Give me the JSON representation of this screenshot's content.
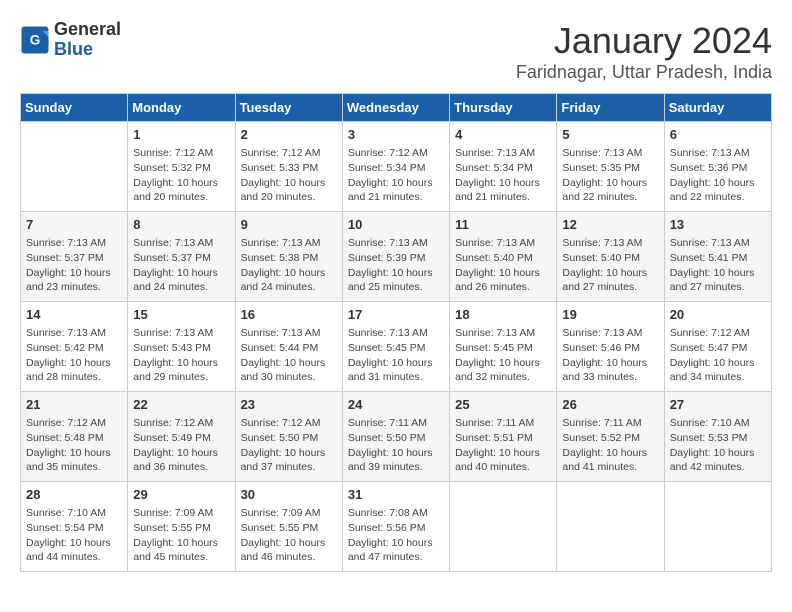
{
  "logo": {
    "general": "General",
    "blue": "Blue"
  },
  "title": "January 2024",
  "subtitle": "Faridnagar, Uttar Pradesh, India",
  "days": [
    "Sunday",
    "Monday",
    "Tuesday",
    "Wednesday",
    "Thursday",
    "Friday",
    "Saturday"
  ],
  "weeks": [
    [
      {
        "day": "",
        "content": ""
      },
      {
        "day": "1",
        "content": "Sunrise: 7:12 AM\nSunset: 5:32 PM\nDaylight: 10 hours\nand 20 minutes."
      },
      {
        "day": "2",
        "content": "Sunrise: 7:12 AM\nSunset: 5:33 PM\nDaylight: 10 hours\nand 20 minutes."
      },
      {
        "day": "3",
        "content": "Sunrise: 7:12 AM\nSunset: 5:34 PM\nDaylight: 10 hours\nand 21 minutes."
      },
      {
        "day": "4",
        "content": "Sunrise: 7:13 AM\nSunset: 5:34 PM\nDaylight: 10 hours\nand 21 minutes."
      },
      {
        "day": "5",
        "content": "Sunrise: 7:13 AM\nSunset: 5:35 PM\nDaylight: 10 hours\nand 22 minutes."
      },
      {
        "day": "6",
        "content": "Sunrise: 7:13 AM\nSunset: 5:36 PM\nDaylight: 10 hours\nand 22 minutes."
      }
    ],
    [
      {
        "day": "7",
        "content": "Sunrise: 7:13 AM\nSunset: 5:37 PM\nDaylight: 10 hours\nand 23 minutes."
      },
      {
        "day": "8",
        "content": "Sunrise: 7:13 AM\nSunset: 5:37 PM\nDaylight: 10 hours\nand 24 minutes."
      },
      {
        "day": "9",
        "content": "Sunrise: 7:13 AM\nSunset: 5:38 PM\nDaylight: 10 hours\nand 24 minutes."
      },
      {
        "day": "10",
        "content": "Sunrise: 7:13 AM\nSunset: 5:39 PM\nDaylight: 10 hours\nand 25 minutes."
      },
      {
        "day": "11",
        "content": "Sunrise: 7:13 AM\nSunset: 5:40 PM\nDaylight: 10 hours\nand 26 minutes."
      },
      {
        "day": "12",
        "content": "Sunrise: 7:13 AM\nSunset: 5:40 PM\nDaylight: 10 hours\nand 27 minutes."
      },
      {
        "day": "13",
        "content": "Sunrise: 7:13 AM\nSunset: 5:41 PM\nDaylight: 10 hours\nand 27 minutes."
      }
    ],
    [
      {
        "day": "14",
        "content": "Sunrise: 7:13 AM\nSunset: 5:42 PM\nDaylight: 10 hours\nand 28 minutes."
      },
      {
        "day": "15",
        "content": "Sunrise: 7:13 AM\nSunset: 5:43 PM\nDaylight: 10 hours\nand 29 minutes."
      },
      {
        "day": "16",
        "content": "Sunrise: 7:13 AM\nSunset: 5:44 PM\nDaylight: 10 hours\nand 30 minutes."
      },
      {
        "day": "17",
        "content": "Sunrise: 7:13 AM\nSunset: 5:45 PM\nDaylight: 10 hours\nand 31 minutes."
      },
      {
        "day": "18",
        "content": "Sunrise: 7:13 AM\nSunset: 5:45 PM\nDaylight: 10 hours\nand 32 minutes."
      },
      {
        "day": "19",
        "content": "Sunrise: 7:13 AM\nSunset: 5:46 PM\nDaylight: 10 hours\nand 33 minutes."
      },
      {
        "day": "20",
        "content": "Sunrise: 7:12 AM\nSunset: 5:47 PM\nDaylight: 10 hours\nand 34 minutes."
      }
    ],
    [
      {
        "day": "21",
        "content": "Sunrise: 7:12 AM\nSunset: 5:48 PM\nDaylight: 10 hours\nand 35 minutes."
      },
      {
        "day": "22",
        "content": "Sunrise: 7:12 AM\nSunset: 5:49 PM\nDaylight: 10 hours\nand 36 minutes."
      },
      {
        "day": "23",
        "content": "Sunrise: 7:12 AM\nSunset: 5:50 PM\nDaylight: 10 hours\nand 37 minutes."
      },
      {
        "day": "24",
        "content": "Sunrise: 7:11 AM\nSunset: 5:50 PM\nDaylight: 10 hours\nand 39 minutes."
      },
      {
        "day": "25",
        "content": "Sunrise: 7:11 AM\nSunset: 5:51 PM\nDaylight: 10 hours\nand 40 minutes."
      },
      {
        "day": "26",
        "content": "Sunrise: 7:11 AM\nSunset: 5:52 PM\nDaylight: 10 hours\nand 41 minutes."
      },
      {
        "day": "27",
        "content": "Sunrise: 7:10 AM\nSunset: 5:53 PM\nDaylight: 10 hours\nand 42 minutes."
      }
    ],
    [
      {
        "day": "28",
        "content": "Sunrise: 7:10 AM\nSunset: 5:54 PM\nDaylight: 10 hours\nand 44 minutes."
      },
      {
        "day": "29",
        "content": "Sunrise: 7:09 AM\nSunset: 5:55 PM\nDaylight: 10 hours\nand 45 minutes."
      },
      {
        "day": "30",
        "content": "Sunrise: 7:09 AM\nSunset: 5:55 PM\nDaylight: 10 hours\nand 46 minutes."
      },
      {
        "day": "31",
        "content": "Sunrise: 7:08 AM\nSunset: 5:56 PM\nDaylight: 10 hours\nand 47 minutes."
      },
      {
        "day": "",
        "content": ""
      },
      {
        "day": "",
        "content": ""
      },
      {
        "day": "",
        "content": ""
      }
    ]
  ]
}
